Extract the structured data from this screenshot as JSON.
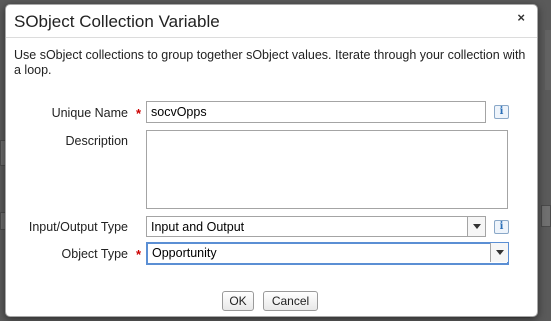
{
  "dialog": {
    "title": "SObject Collection Variable",
    "description": "Use sObject collections to group together sObject values. Iterate through your collection with a loop.",
    "close_label": "×"
  },
  "fields": {
    "unique_name": {
      "label": "Unique Name",
      "value": "socvOpps",
      "required_mark": "*"
    },
    "description": {
      "label": "Description",
      "value": ""
    },
    "io_type": {
      "label": "Input/Output Type",
      "value": "Input and Output"
    },
    "object_type": {
      "label": "Object Type",
      "value": "Opportunity",
      "required_mark": "*"
    }
  },
  "info_label": "i",
  "buttons": {
    "ok": "OK",
    "cancel": "Cancel"
  },
  "colors": {
    "required": "#cc0000",
    "focus_border": "#5b8fd4",
    "info": "#2a6fb8"
  }
}
